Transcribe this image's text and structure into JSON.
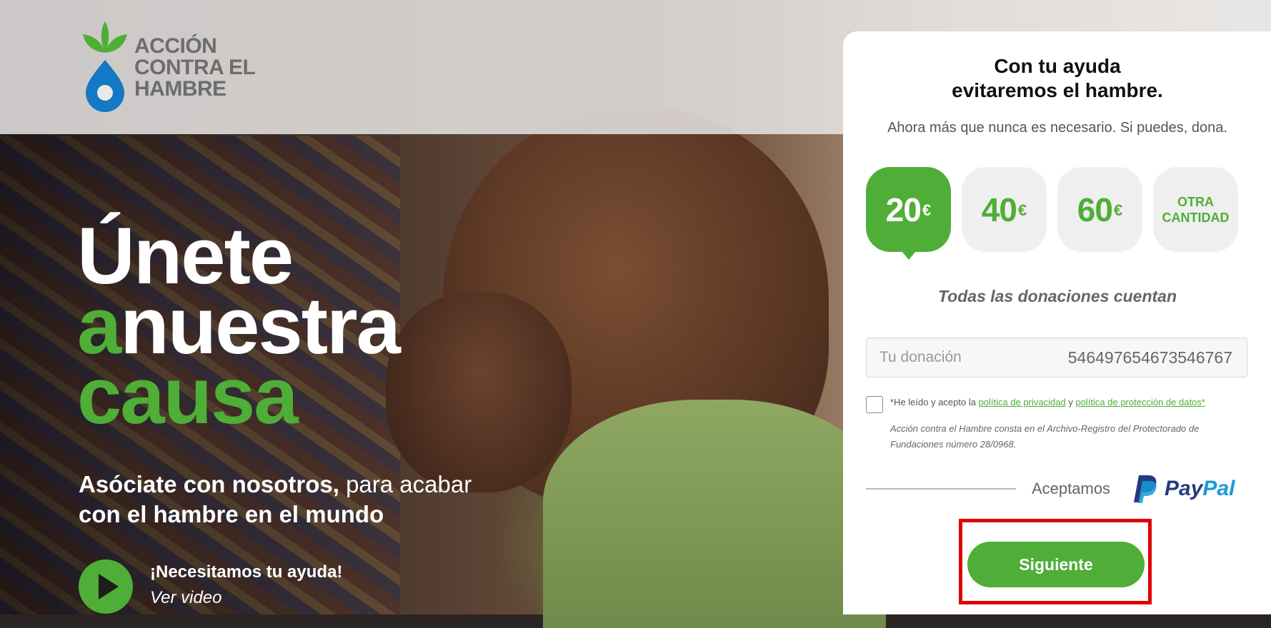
{
  "brand": {
    "logo_line1": "ACCIÓN",
    "logo_line2": "CONTRA EL",
    "logo_line3": "HAMBRE",
    "green": "#4fae37",
    "blue": "#1578c4"
  },
  "hero": {
    "headline_line1": "Únete",
    "headline_a": "a",
    "headline_line2": "nuestra",
    "headline_line3": "causa",
    "sub_bold": "Asóciate con nosotros,",
    "sub_rest": " para acabar",
    "sub_line2": "con el hambre en el mundo",
    "video_title": "¡Necesitamos tu ayuda!",
    "video_link": "Ver video"
  },
  "card": {
    "title_line1": "Con tu ayuda",
    "title_line2": "evitaremos el hambre.",
    "subtitle": "Ahora más que nunca es necesario. Si puedes, dona.",
    "currency": "€",
    "amounts": [
      {
        "value": "20",
        "selected": true
      },
      {
        "value": "40",
        "selected": false
      },
      {
        "value": "60",
        "selected": false
      }
    ],
    "other_line1": "OTRA",
    "other_line2": "CANTIDAD",
    "tagline": "Todas las donaciones cuentan",
    "donation_label": "Tu donación",
    "donation_value": "546497654673546767",
    "legal_prefix": "*He leído y acepto la ",
    "privacy_link": "política de privacidad",
    "legal_and": " y ",
    "data_link": "política de protección de datos*",
    "registry": "Acción contra el Hambre consta en el Archivo-Registro del Protectorado de Fundaciones número 28/0968.",
    "accept_text": "Aceptamos",
    "paypal_pay": "Pay",
    "paypal_pal": "Pal",
    "next_button": "Siguiente"
  }
}
